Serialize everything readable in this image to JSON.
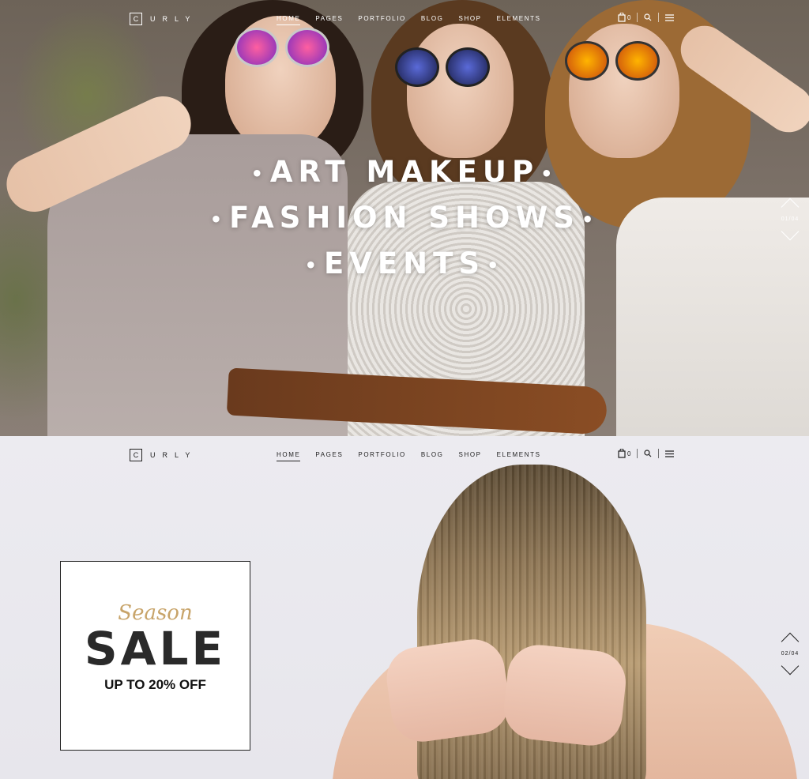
{
  "brand": {
    "logo_letter": "C",
    "logo_text": "URLY"
  },
  "nav": {
    "items": [
      "HOME",
      "PAGES",
      "PORTFOLIO",
      "BLOG",
      "SHOP",
      "ELEMENTS"
    ],
    "cart_count": "0"
  },
  "hero1": {
    "lines": [
      "ART MAKEUP",
      "FASHION SHOWS",
      "EVENTS"
    ],
    "slide_counter": "01/04"
  },
  "hero2": {
    "sale_script": "Season",
    "sale_title": "SALE",
    "sale_subtitle": "UP TO 20% OFF",
    "slide_counter": "02/04"
  }
}
